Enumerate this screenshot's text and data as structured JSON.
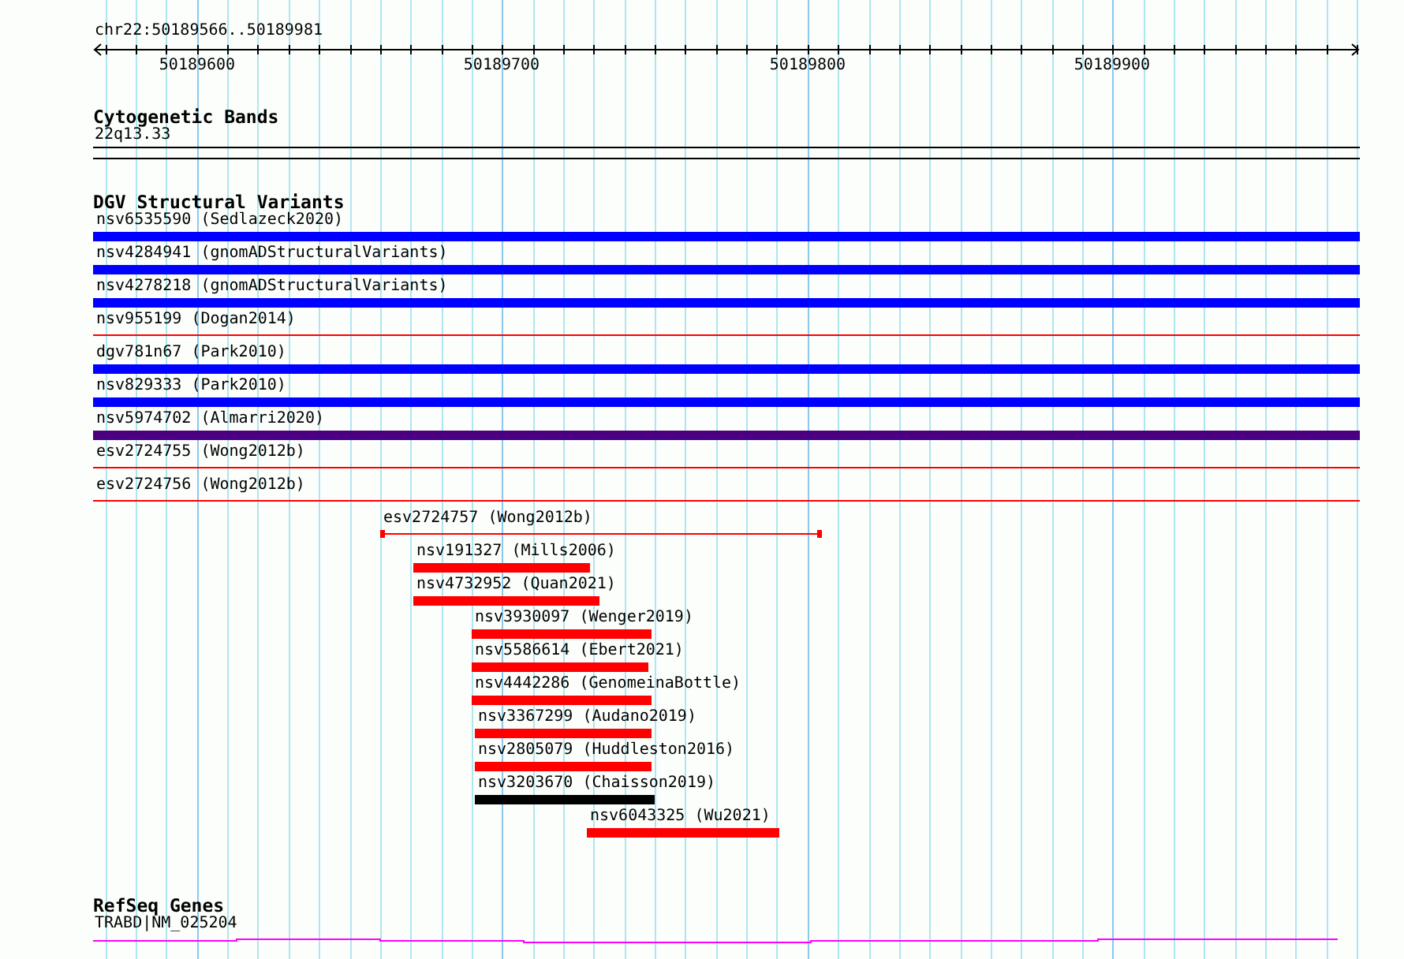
{
  "ruler": {
    "location": "chr22:50189566..50189981",
    "tick_labels": [
      "50189600",
      "50189700",
      "50189800",
      "50189900"
    ]
  },
  "tracks": [
    {
      "kind": "bands",
      "title": "Cytogenetic Bands",
      "band_label": "22q13.33"
    },
    {
      "kind": "variants",
      "title": "DGV Structural Variants",
      "features": [
        {
          "label": "nsv6535590 (Sedlazeck2020)",
          "kind": "thick",
          "color": "#0000ff"
        },
        {
          "label": "nsv4284941 (gnomADStructuralVariants)",
          "kind": "thick",
          "color": "#0000ff"
        },
        {
          "label": "nsv4278218 (gnomADStructuralVariants)",
          "kind": "thick",
          "color": "#0000ff"
        },
        {
          "label": "nsv955199 (Dogan2014)",
          "kind": "thin",
          "color": "#ff0000"
        },
        {
          "label": "dgv781n67 (Park2010)",
          "kind": "thick",
          "color": "#0000ff"
        },
        {
          "label": "nsv829333 (Park2010)",
          "kind": "thick",
          "color": "#0000ff"
        },
        {
          "label": "nsv5974702 (Almarri2020)",
          "kind": "thick",
          "color": "#4b0082"
        },
        {
          "label": "esv2724755 (Wong2012b)",
          "kind": "thin",
          "color": "#ff0000"
        },
        {
          "label": "esv2724756 (Wong2012b)",
          "kind": "thin",
          "color": "#ff0000"
        },
        {
          "label": "esv2724757 (Wong2012b)",
          "kind": "capped",
          "color": "#ff0000"
        },
        {
          "label": "nsv191327 (Mills2006)",
          "kind": "thick",
          "color": "#ff0000"
        },
        {
          "label": "nsv4732952 (Quan2021)",
          "kind": "thick",
          "color": "#ff0000"
        },
        {
          "label": "nsv3930097 (Wenger2019)",
          "kind": "thick",
          "color": "#ff0000"
        },
        {
          "label": "nsv5586614 (Ebert2021)",
          "kind": "thick",
          "color": "#ff0000"
        },
        {
          "label": "nsv4442286 (GenomeinaBottle)",
          "kind": "thick",
          "color": "#ff0000"
        },
        {
          "label": "nsv3367299 (Audano2019)",
          "kind": "thick",
          "color": "#ff0000"
        },
        {
          "label": "nsv2805079 (Huddleston2016)",
          "kind": "thick",
          "color": "#ff0000"
        },
        {
          "label": "nsv3203670 (Chaisson2019)",
          "kind": "thick",
          "color": "#000000"
        },
        {
          "label": "nsv6043325 (Wu2021)",
          "kind": "thick",
          "color": "#ff0000"
        }
      ]
    },
    {
      "kind": "genes",
      "title": "RefSeq Genes",
      "gene_label": "TRABD|NM_025204"
    }
  ]
}
